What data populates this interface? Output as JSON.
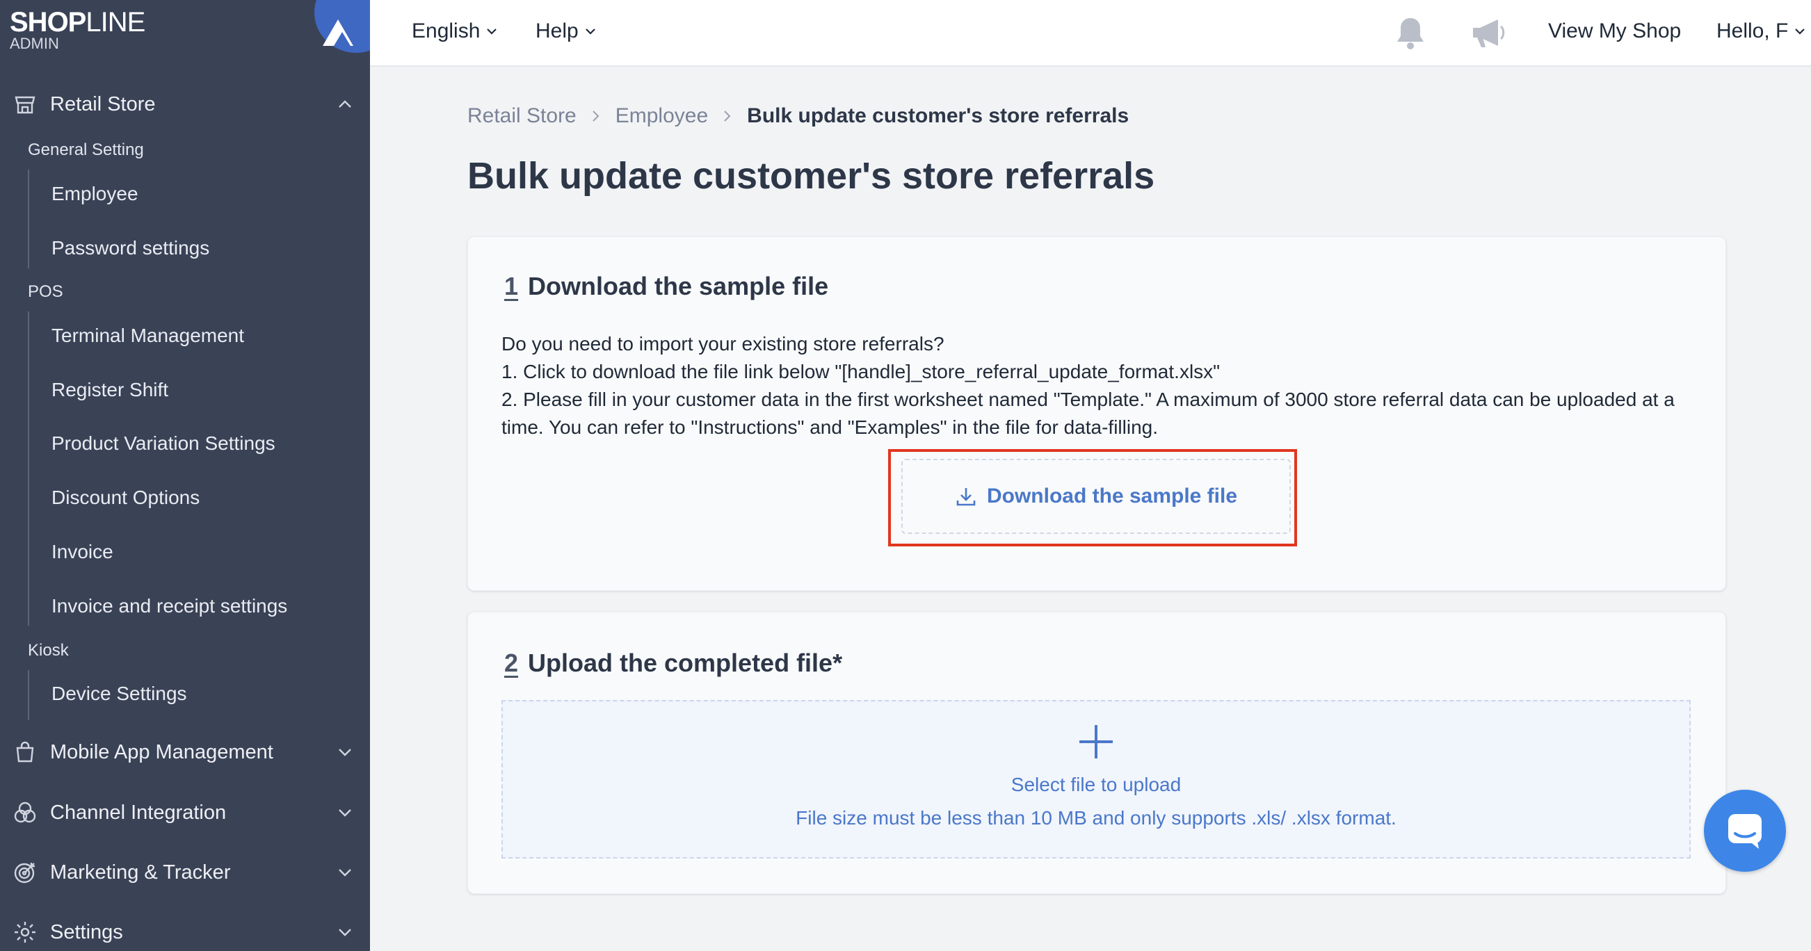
{
  "brand": {
    "logo_bold": "SHOP",
    "logo_thin": "LINE",
    "sub": "ADMIN"
  },
  "sidebar": {
    "retail_store": "Retail Store",
    "general_setting": "General Setting",
    "general_items": [
      "Employee",
      "Password settings"
    ],
    "pos": "POS",
    "pos_items": [
      "Terminal Management",
      "Register Shift",
      "Product Variation Settings",
      "Discount Options",
      "Invoice",
      "Invoice and receipt settings"
    ],
    "kiosk": "Kiosk",
    "kiosk_items": [
      "Device Settings"
    ],
    "mobile_app": "Mobile App Management",
    "channel": "Channel Integration",
    "marketing": "Marketing & Tracker",
    "settings": "Settings"
  },
  "header": {
    "language": "English",
    "help": "Help",
    "view_shop": "View My Shop",
    "hello": "Hello, F"
  },
  "breadcrumb": [
    "Retail Store",
    "Employee",
    "Bulk update customer's store referrals"
  ],
  "page_title": "Bulk update customer's store referrals",
  "step1": {
    "num": "1",
    "title": "Download the sample file",
    "lines": [
      "Do you need to import your existing store referrals?",
      "1. Click to download the file link below \"[handle]_store_referral_update_format.xlsx\"",
      "2. Please fill in your customer data in the first worksheet named \"Template.\" A maximum of 3000 store referral data can be uploaded at a time. You can refer to \"Instructions\" and \"Examples\" in the file for data-filling."
    ],
    "button": "Download the sample file"
  },
  "step2": {
    "num": "2",
    "title": "Upload the completed file*",
    "select": "Select file to upload",
    "hint": "File size must be less than 10 MB and only supports .xls/ .xlsx format."
  },
  "colors": {
    "sidebar": "#3a4256",
    "accent": "#4a78c9",
    "highlight": "#e0371f"
  }
}
